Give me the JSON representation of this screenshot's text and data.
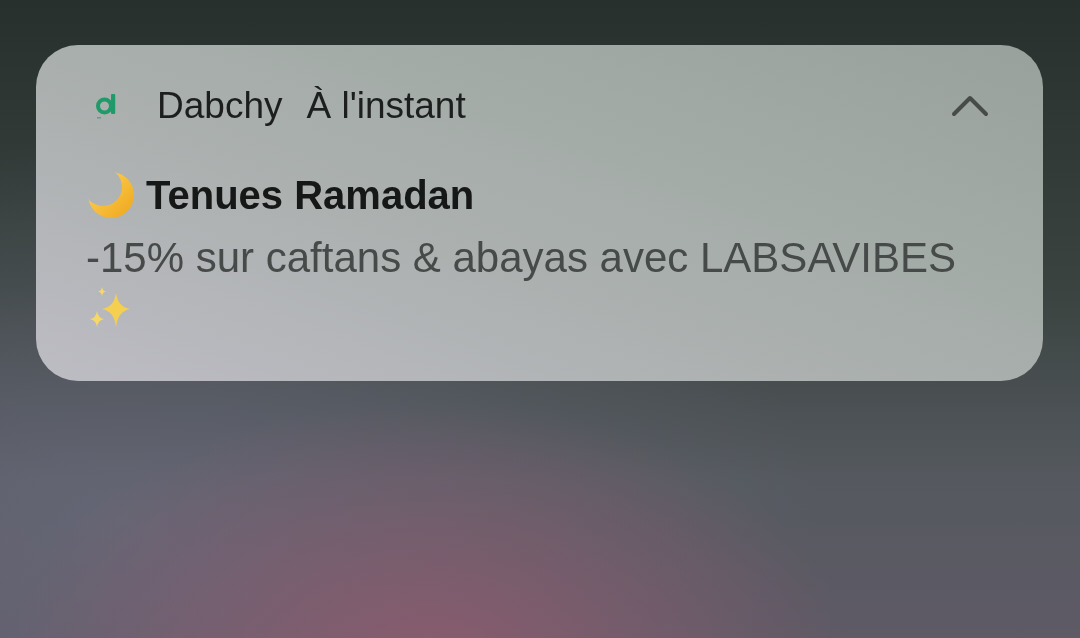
{
  "notification": {
    "app_name": "Dabchy",
    "time": "À l'instant",
    "expanded": true,
    "title": "Tenues Ramadan",
    "message": "-15% sur caftans & abayas avec LABSAVIBES"
  }
}
